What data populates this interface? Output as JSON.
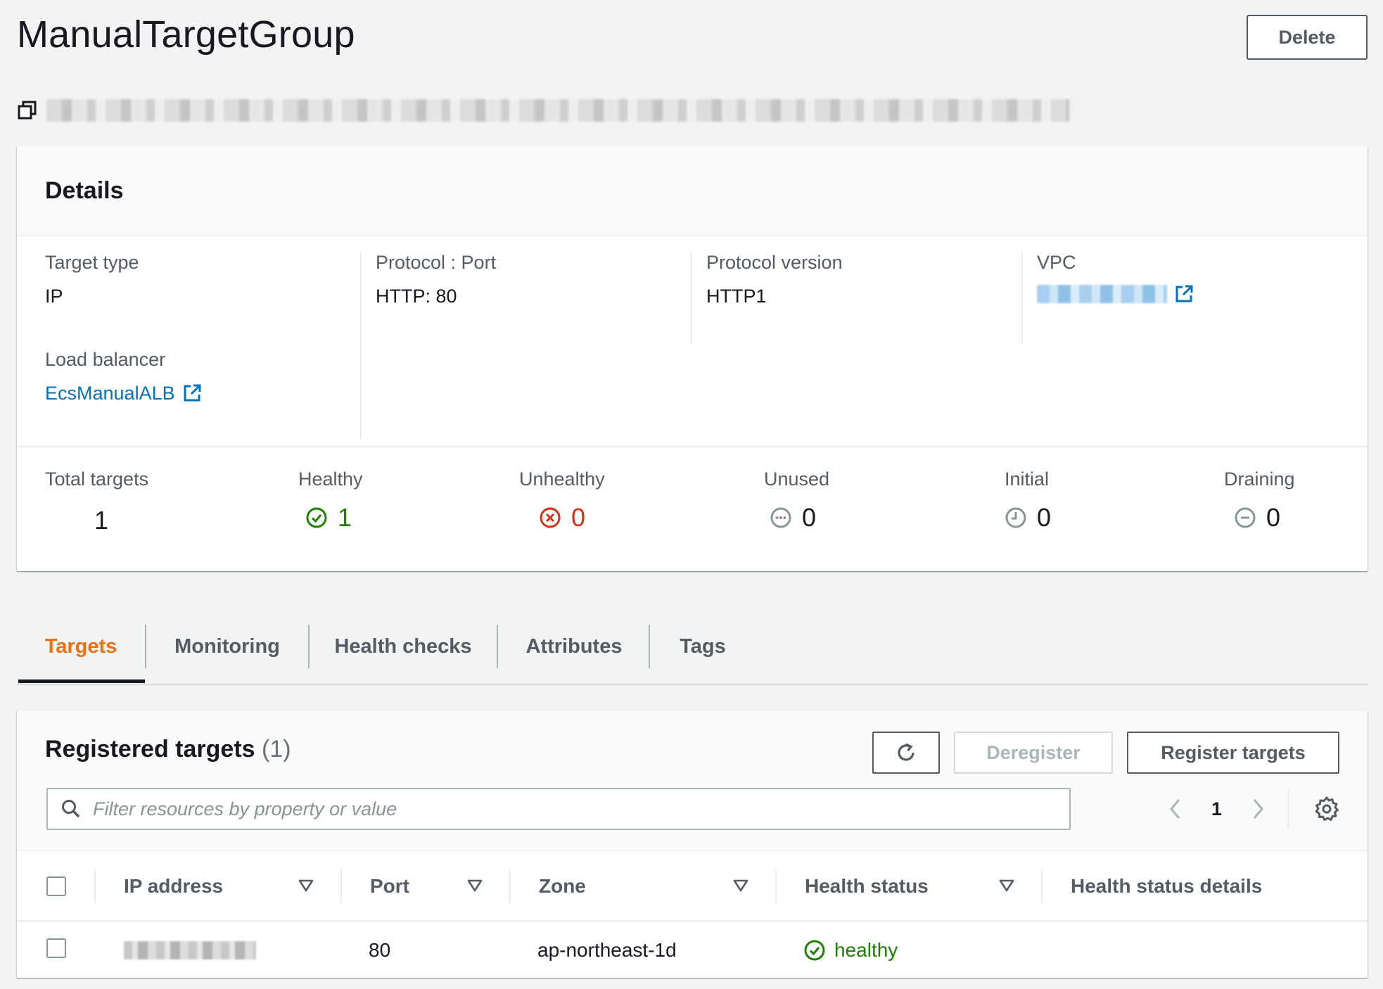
{
  "page": {
    "title": "ManualTargetGroup",
    "delete_label": "Delete"
  },
  "details": {
    "heading": "Details",
    "target_type_label": "Target type",
    "target_type_value": "IP",
    "protocol_port_label": "Protocol : Port",
    "protocol_port_value": "HTTP: 80",
    "protocol_version_label": "Protocol version",
    "protocol_version_value": "HTTP1",
    "vpc_label": "VPC",
    "load_balancer_label": "Load balancer",
    "load_balancer_value": "EcsManualALB"
  },
  "stats": {
    "total_label": "Total targets",
    "total_value": "1",
    "healthy_label": "Healthy",
    "healthy_value": "1",
    "unhealthy_label": "Unhealthy",
    "unhealthy_value": "0",
    "unused_label": "Unused",
    "unused_value": "0",
    "initial_label": "Initial",
    "initial_value": "0",
    "draining_label": "Draining",
    "draining_value": "0"
  },
  "tabs": [
    "Targets",
    "Monitoring",
    "Health checks",
    "Attributes",
    "Tags"
  ],
  "registered": {
    "title": "Registered targets",
    "count": "(1)",
    "deregister_label": "Deregister",
    "register_label": "Register targets",
    "filter_placeholder": "Filter resources by property or value",
    "page_number": "1",
    "columns": [
      "IP address",
      "Port",
      "Zone",
      "Health status",
      "Health status details"
    ],
    "rows": [
      {
        "port": "80",
        "zone": "ap-northeast-1d",
        "health_status": "healthy"
      }
    ]
  },
  "colors": {
    "accent": "#ec7211",
    "link": "#0073bb",
    "healthy": "#1d8102",
    "unhealthy": "#d13212",
    "neutral": "#879596"
  },
  "icons": {
    "copy": "copy-icon",
    "external": "external-link-icon",
    "healthy": "check-circle-icon",
    "unhealthy": "x-circle-icon",
    "unused": "ellipsis-circle-icon",
    "initial": "clock-icon",
    "draining": "minus-circle-icon",
    "refresh": "refresh-icon",
    "search": "search-icon",
    "settings": "gear-icon"
  }
}
